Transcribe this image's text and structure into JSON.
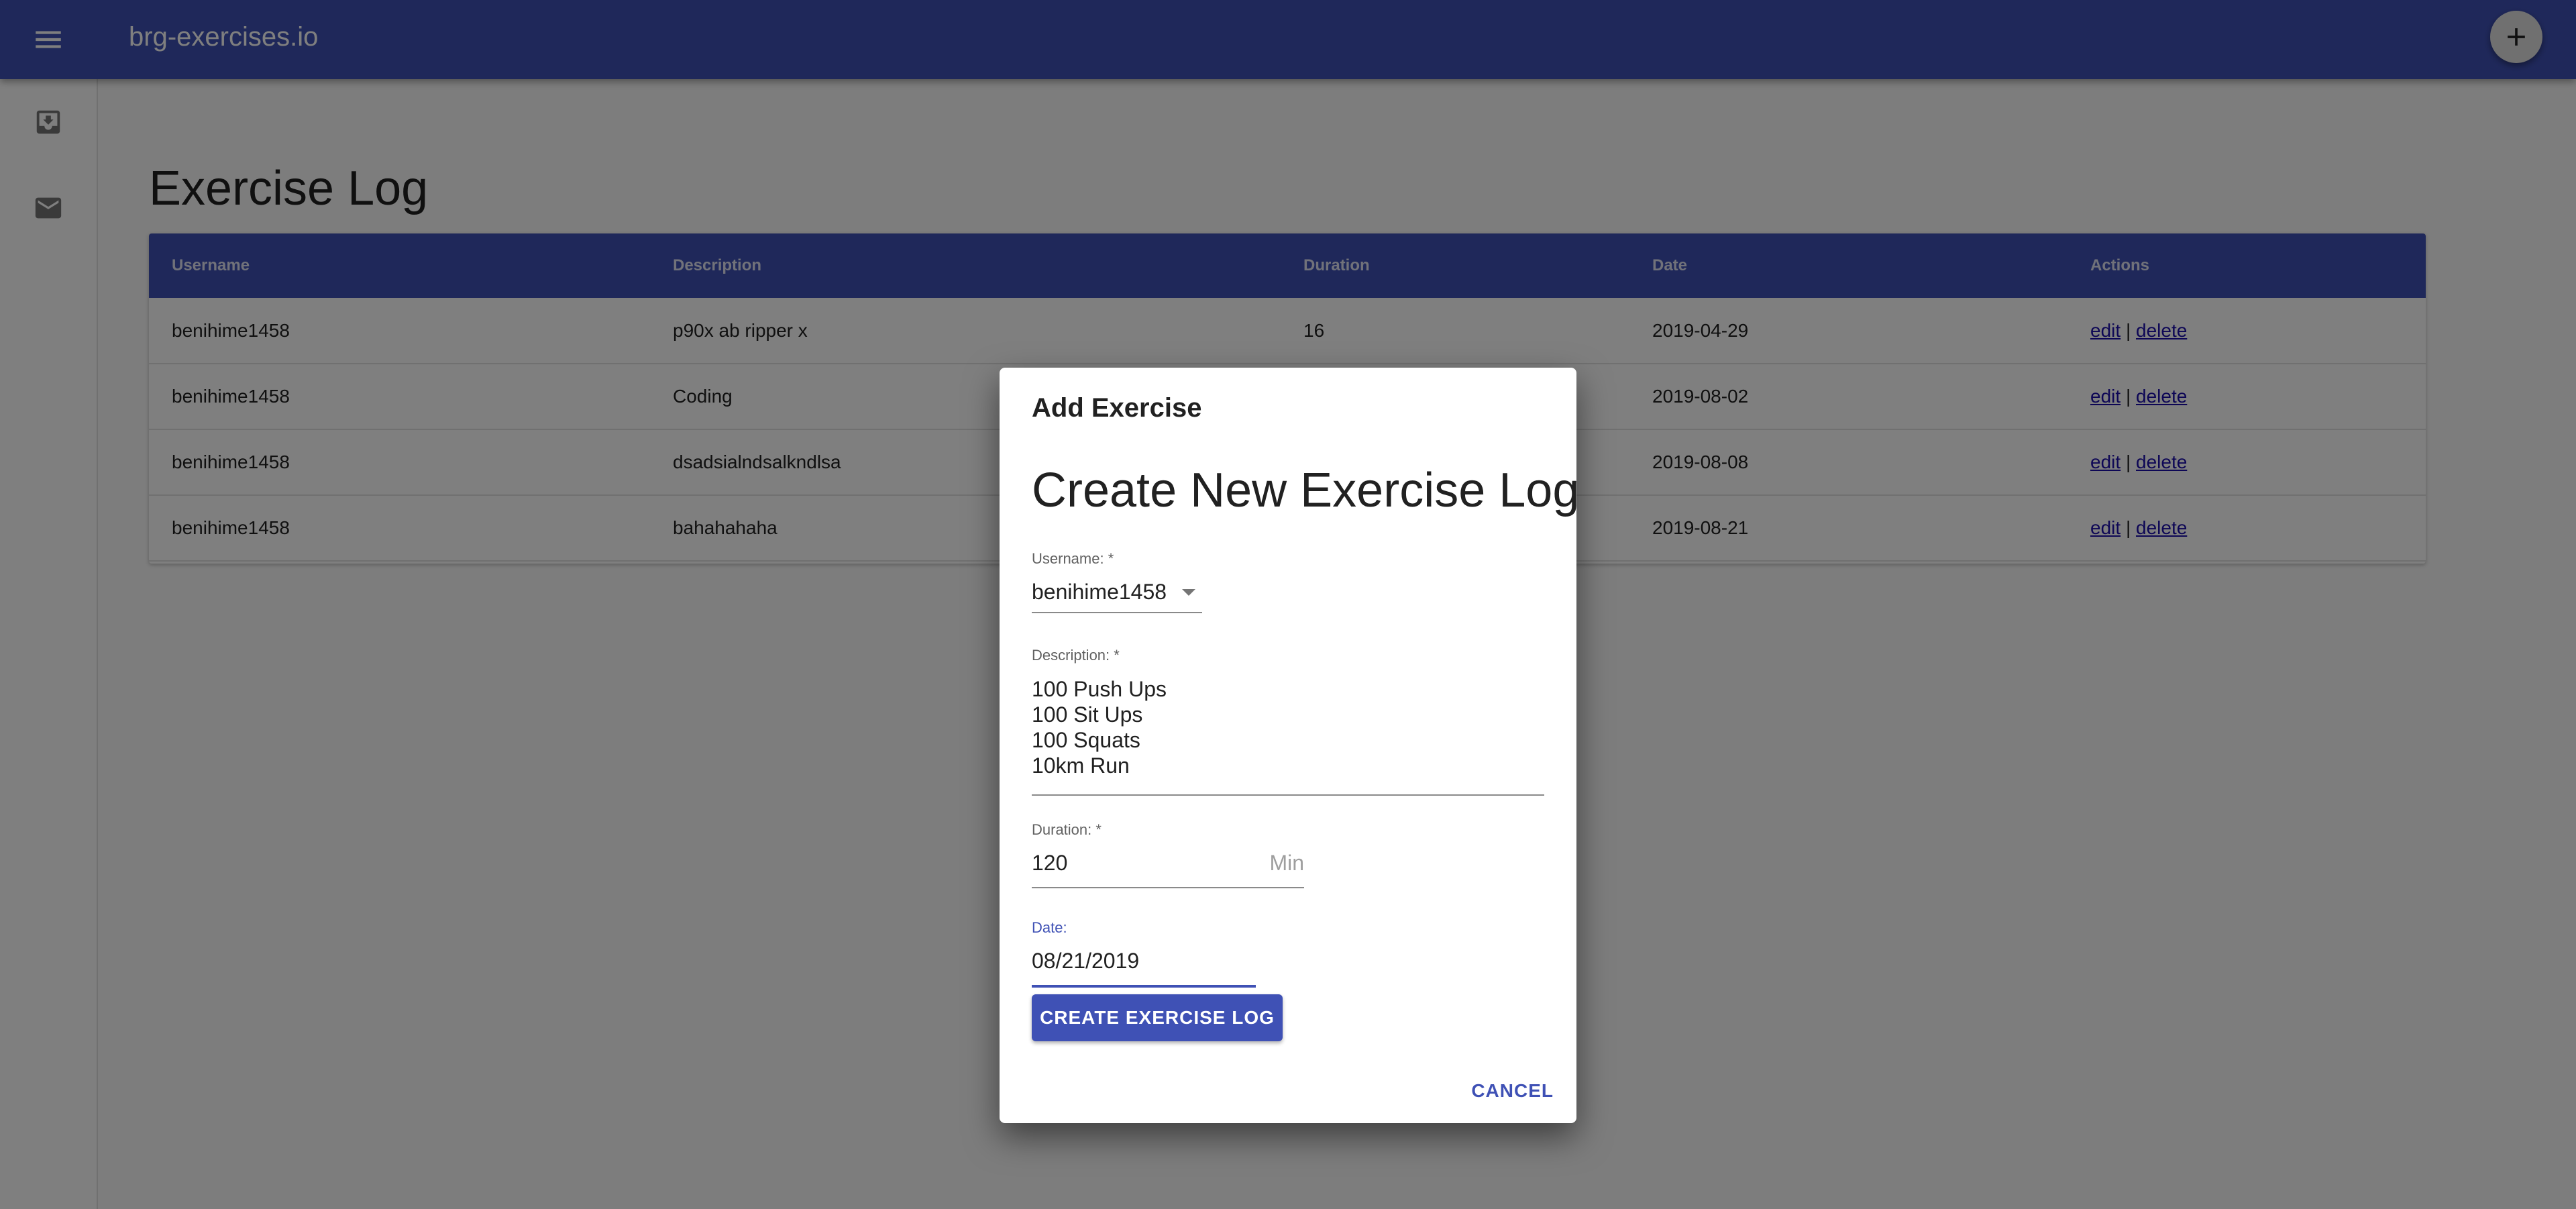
{
  "app": {
    "title": "brg-exercises.io",
    "accent": "#3f51b5"
  },
  "drawer": {
    "items": [
      {
        "icon": "move-to-inbox-icon"
      },
      {
        "icon": "mail-icon"
      }
    ]
  },
  "page": {
    "heading": "Exercise Log"
  },
  "table": {
    "headers": [
      "Username",
      "Description",
      "Duration",
      "Date",
      "Actions"
    ],
    "rows": [
      {
        "username": "benihime1458",
        "description": "p90x ab ripper x",
        "duration": "16",
        "date": "2019-04-29",
        "edit": "edit",
        "sep": "|",
        "delete": "delete"
      },
      {
        "username": "benihime1458",
        "description": "Coding",
        "duration": "",
        "date": "2019-08-02",
        "edit": "edit",
        "sep": "|",
        "delete": "delete"
      },
      {
        "username": "benihime1458",
        "description": "dsadsialndsalkndlsa",
        "duration": "",
        "date": "2019-08-08",
        "edit": "edit",
        "sep": "|",
        "delete": "delete"
      },
      {
        "username": "benihime1458",
        "description": "bahahahaha",
        "duration": "",
        "date": "2019-08-21",
        "edit": "edit",
        "sep": "|",
        "delete": "delete"
      }
    ]
  },
  "dialog": {
    "title": "Add Exercise",
    "form_heading": "Create New Exercise Log",
    "username": {
      "label": "Username: *",
      "value": "benihime1458"
    },
    "description": {
      "label": "Description:  *",
      "lines": [
        "100 Push Ups",
        "100 Sit Ups",
        "100 Squats",
        "10km Run"
      ]
    },
    "duration": {
      "label": "Duration:  *",
      "value": "120",
      "unit": "Min"
    },
    "date": {
      "label": "Date:",
      "value": "08/21/2019"
    },
    "create_label": "CREATE EXERCISE LOG",
    "cancel_label": "CANCEL"
  }
}
